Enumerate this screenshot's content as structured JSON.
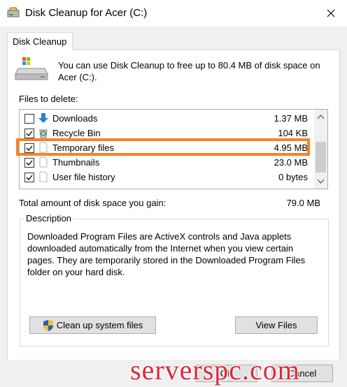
{
  "window": {
    "title": "Disk Cleanup for Acer (C:)"
  },
  "tabs": [
    {
      "label": "Disk Cleanup"
    }
  ],
  "intro_text": "You can use Disk Cleanup to free up to 80.4 MB of disk space on Acer (C:).",
  "files_label": "Files to delete:",
  "files": [
    {
      "label": "Downloads",
      "size": "1.37 MB",
      "checked": false,
      "icon": "download-arrow-icon"
    },
    {
      "label": "Recycle Bin",
      "size": "104 KB",
      "checked": true,
      "icon": "recycle-bin-icon"
    },
    {
      "label": "Temporary files",
      "size": "4.95 MB",
      "checked": true,
      "icon": "blank-file-icon"
    },
    {
      "label": "Thumbnails",
      "size": "23.0 MB",
      "checked": true,
      "icon": "blank-file-icon"
    },
    {
      "label": "User file history",
      "size": "0 bytes",
      "checked": true,
      "icon": "blank-file-icon"
    }
  ],
  "total": {
    "label": "Total amount of disk space you gain:",
    "value": "79.0 MB"
  },
  "description": {
    "legend": "Description",
    "text": "Downloaded Program Files are ActiveX controls and Java applets downloaded automatically from the Internet when you view certain pages. They are temporarily stored in the Downloaded Program Files folder on your hard disk."
  },
  "buttons": {
    "cleanup_system": "Clean up system files",
    "view_files": "View Files",
    "ok": "OK",
    "cancel": "Cancel"
  },
  "highlight_color": "#f5822a",
  "watermark": "serverspc.com"
}
